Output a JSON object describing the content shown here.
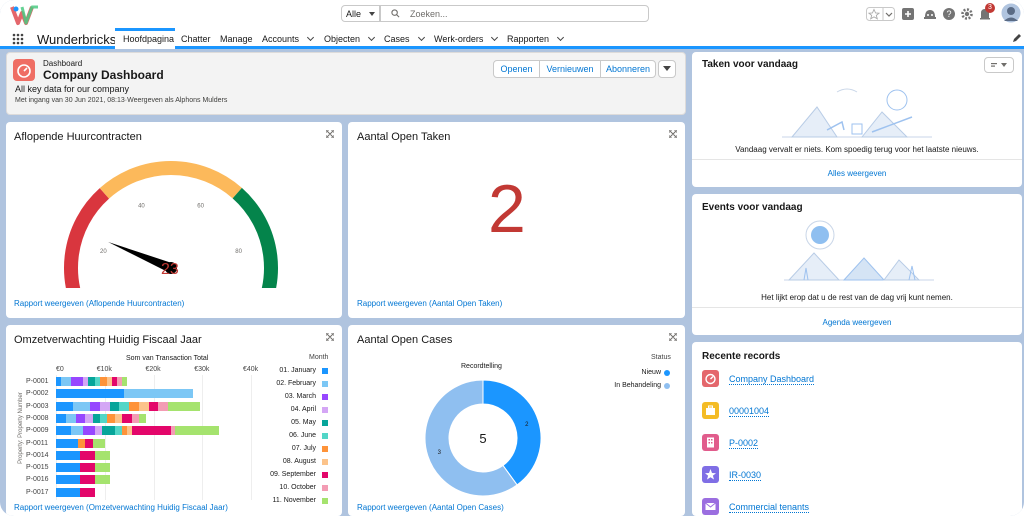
{
  "app": {
    "name": "Wunderbricks",
    "search_scope": "Alle",
    "search_placeholder": "Zoeken...",
    "notification_count": "3"
  },
  "nav": {
    "tabs": [
      "Hoofdpagina",
      "Chatter",
      "Manage",
      "Accounts",
      "Objecten",
      "Cases",
      "Werk-orders",
      "Rapporten"
    ]
  },
  "header": {
    "object": "Dashboard",
    "title": "Company Dashboard",
    "subtitle": "All key data for our company",
    "meta": "Met ingang van 30 Jun 2021, 08:13·Weergeven als Alphons Mulders",
    "buttons": [
      "Openen",
      "Vernieuwen",
      "Abonneren"
    ]
  },
  "gauge_card": {
    "title": "Aflopende Huurcontracten",
    "value": "23",
    "value_num": 23,
    "max": 100,
    "ticks": [
      "0",
      "20",
      "40",
      "60",
      "80",
      "100"
    ],
    "link": "Rapport weergeven (Aflopende Huurcontracten)",
    "colors": {
      "low": "#d9363e",
      "mid": "#fcb95b",
      "high": "#04844b",
      "needle": "#000000",
      "value": "#c23934"
    }
  },
  "taken_card": {
    "title": "Aantal Open Taken",
    "value": "2",
    "link": "Rapport weergeven (Aantal Open Taken)"
  },
  "omzet_card": {
    "title": "Omzetverwachting Huidig Fiscaal Jaar",
    "link": "Rapport weergeven (Omzetverwachting Huidig Fiscaal Jaar)"
  },
  "cases_card": {
    "title": "Aantal Open Cases",
    "link": "Rapport weergeven (Aantal Open Cases)"
  },
  "chart_data": [
    {
      "type": "bar",
      "orientation": "horizontal",
      "stacked": true,
      "title": "Som van Transaction Total",
      "ylabel": "Property: Property Number",
      "x_ticks": [
        "€0",
        "€10k",
        "€20k",
        "€30k",
        "€40k"
      ],
      "xlim": [
        0,
        40000
      ],
      "legend_title": "Month",
      "legend_position": "right",
      "categories": [
        "P-0001",
        "P-0002",
        "P-0003",
        "P-0008",
        "P-0009",
        "P-0011",
        "P-0014",
        "P-0015",
        "P-0016",
        "P-0017"
      ],
      "series": [
        {
          "name": "01. January",
          "color": "#1b96ff",
          "values": [
            1000,
            14000,
            3500,
            2000,
            3000,
            4500,
            5000,
            5000,
            5000,
            5000
          ]
        },
        {
          "name": "02. February",
          "color": "#7cc7f5",
          "values": [
            2000,
            14000,
            3500,
            2000,
            2500,
            0,
            0,
            0,
            0,
            0
          ]
        },
        {
          "name": "03. March",
          "color": "#9747ff",
          "values": [
            2500,
            0,
            2000,
            2000,
            2500,
            0,
            0,
            0,
            0,
            0
          ]
        },
        {
          "name": "04. April",
          "color": "#d4a6f5",
          "values": [
            1000,
            0,
            2000,
            1500,
            1500,
            0,
            0,
            0,
            0,
            0
          ]
        },
        {
          "name": "05. May",
          "color": "#06a59a",
          "values": [
            1500,
            0,
            2000,
            1500,
            2500,
            0,
            0,
            0,
            0,
            0
          ]
        },
        {
          "name": "06. June",
          "color": "#52d6c7",
          "values": [
            1000,
            0,
            2000,
            1500,
            1500,
            0,
            0,
            0,
            0,
            0
          ]
        },
        {
          "name": "07. July",
          "color": "#fe9339",
          "values": [
            1500,
            0,
            2000,
            1500,
            1000,
            1500,
            0,
            0,
            0,
            0
          ]
        },
        {
          "name": "08. August",
          "color": "#fcc38a",
          "values": [
            1000,
            0,
            2000,
            1500,
            1000,
            0,
            0,
            0,
            0,
            0
          ]
        },
        {
          "name": "09. September",
          "color": "#e3066a",
          "values": [
            1000,
            0,
            2000,
            2000,
            8000,
            1500,
            3000,
            3000,
            3000,
            3000
          ]
        },
        {
          "name": "10. October",
          "color": "#f39cb4",
          "values": [
            1000,
            0,
            2000,
            1500,
            1000,
            0,
            0,
            0,
            0,
            0
          ]
        },
        {
          "name": "11. November",
          "color": "#a5e36e",
          "values": [
            1000,
            0,
            6500,
            1500,
            9000,
            2500,
            3000,
            3000,
            3000,
            0
          ]
        }
      ]
    },
    {
      "type": "pie",
      "donut": true,
      "title": "Recordtelling",
      "legend_title": "Status",
      "legend_position": "right",
      "center_label": "5",
      "categories": [
        "Nieuw",
        "In Behandeling"
      ],
      "values": [
        2,
        3
      ],
      "colors": [
        "#1b96ff",
        "#8fbff0"
      ]
    }
  ],
  "tasks": {
    "title": "Taken voor vandaag",
    "empty": "Vandaag vervalt er niets. Kom spoedig terug voor het laatste nieuws.",
    "link": "Alles weergeven"
  },
  "events": {
    "title": "Events voor vandaag",
    "empty": "Het lijkt erop dat u de rest van de dag vrij kunt nemen.",
    "link": "Agenda weergeven"
  },
  "recent": {
    "title": "Recente records",
    "items": [
      {
        "label": "Company Dashboard",
        "icon": "dashboard-icon",
        "color": "#e4676c"
      },
      {
        "label": "00001004",
        "icon": "case-icon",
        "color": "#f4bc25"
      },
      {
        "label": "P-0002",
        "icon": "building-icon",
        "color": "#e15c8c"
      },
      {
        "label": "IR-0030",
        "icon": "star-icon",
        "color": "#7f6ee5"
      },
      {
        "label": "Commercial tenants",
        "icon": "email-icon",
        "color": "#9b6ee0"
      }
    ]
  }
}
